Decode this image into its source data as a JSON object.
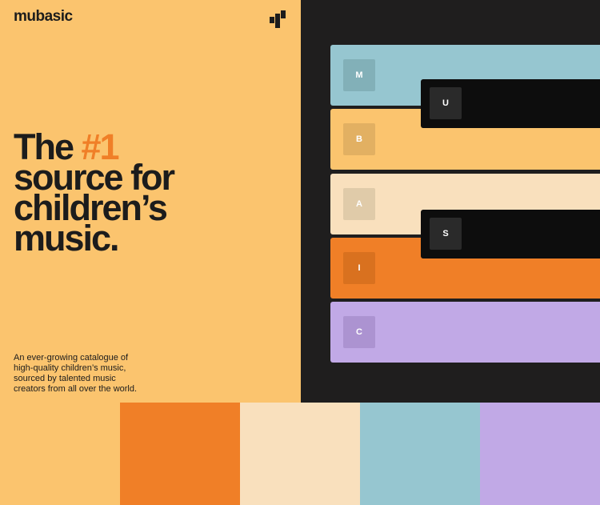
{
  "brand": {
    "name": "mubasic",
    "logo_icon": "mubasic-blocks-logo-icon"
  },
  "hero": {
    "headline_prefix": "The ",
    "headline_accent": "#1",
    "headline_line2": "source for",
    "headline_line3": "children’s",
    "headline_line4": "music.",
    "description": "An ever-growing catalogue of high-quality children’s music, sourced by talented music creators from all over the world."
  },
  "piano_keys": [
    {
      "letter": "M",
      "color": "#96c6d0",
      "badge_color": "#82b0b8"
    },
    {
      "letter": "B",
      "color": "#fbc46e",
      "badge_color": "#e2b062"
    },
    {
      "letter": "A",
      "color": "#f9e0bd",
      "badge_color": "#e0cba9"
    },
    {
      "letter": "I",
      "color": "#f07f27",
      "badge_color": "#d9711f"
    },
    {
      "letter": "C",
      "color": "#c1a9e6",
      "badge_color": "#ac93d1"
    }
  ],
  "black_keys": [
    {
      "letter": "U"
    },
    {
      "letter": "S"
    }
  ],
  "colors": {
    "yellow": "#fbc46e",
    "orange": "#f07f27",
    "cream": "#f9e0bd",
    "blue": "#96c6d0",
    "lavender": "#c1a9e6",
    "dark": "#1f1e1e",
    "text": "#1c1c1c"
  },
  "swatches": [
    "#fbc46e",
    "#f07f27",
    "#f9e0bd",
    "#96c6d0",
    "#c1a9e6"
  ]
}
